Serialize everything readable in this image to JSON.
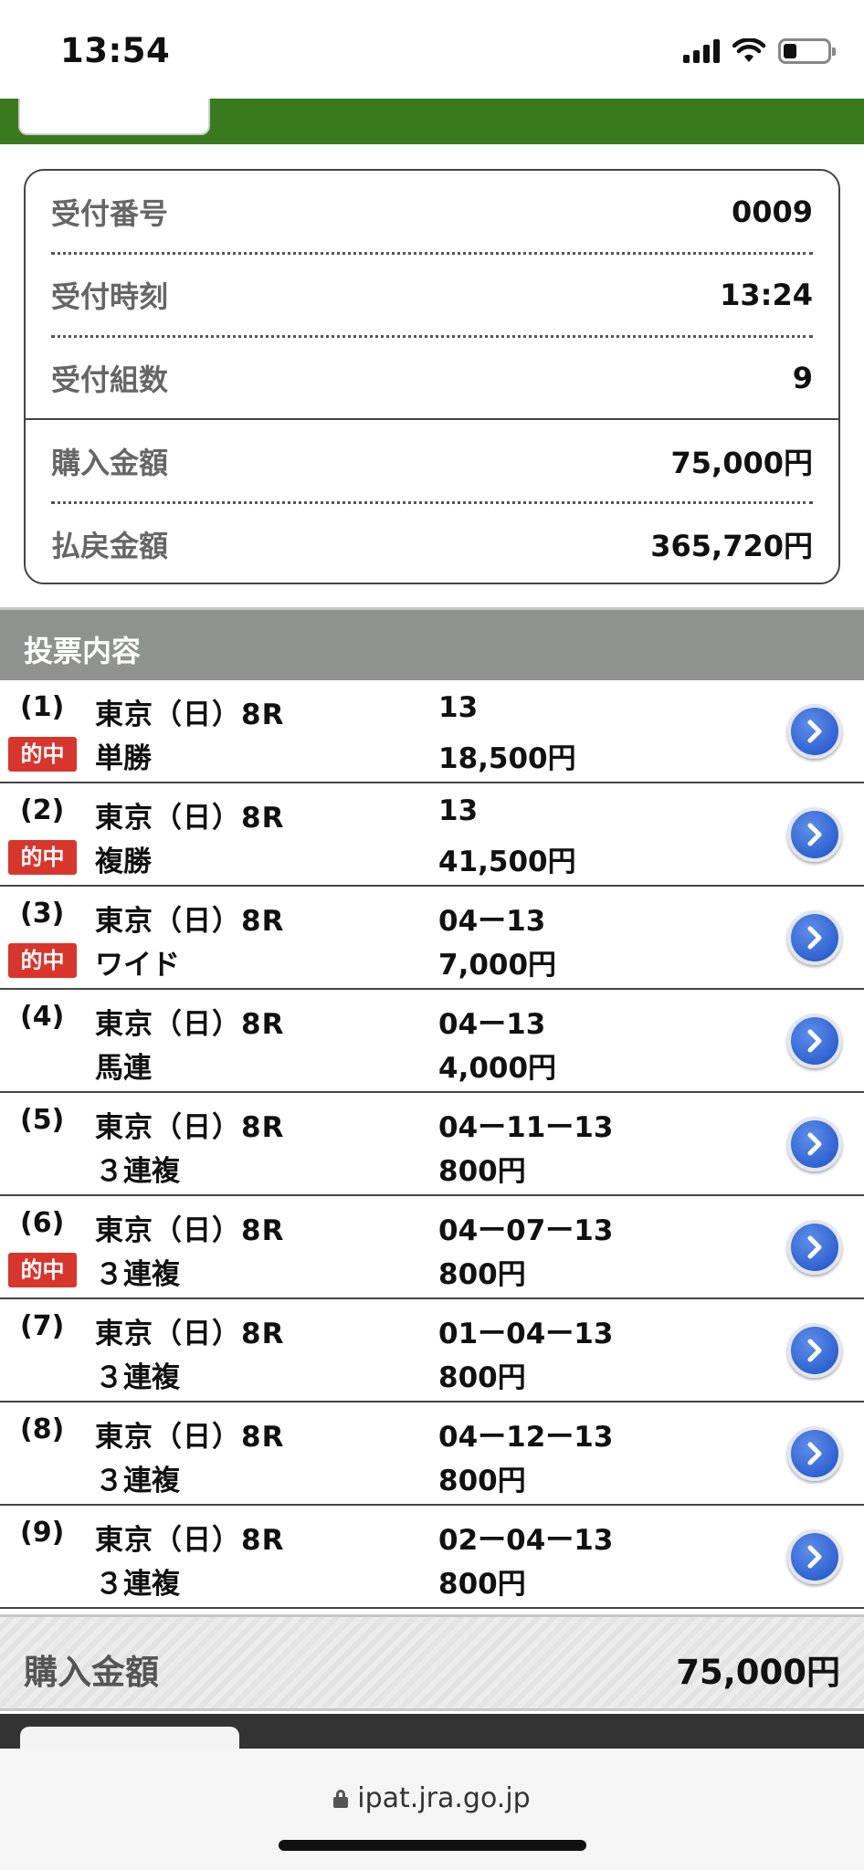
{
  "status_bar": {
    "time": "13:54"
  },
  "header": {
    "back_label": "",
    "title": ""
  },
  "summary": {
    "rows": [
      {
        "label": "受付番号",
        "value": "0009"
      },
      {
        "label": "受付時刻",
        "value": "13:24"
      },
      {
        "label": "受付組数",
        "value": "9"
      },
      {
        "label": "購入金額",
        "value": "75,000円"
      },
      {
        "label": "払戻金額",
        "value": "365,720円"
      }
    ]
  },
  "section": {
    "title": "投票内容"
  },
  "bets": [
    {
      "no": "(1)",
      "race": "東京（日）8R",
      "type": "単勝",
      "combo": "13",
      "amount": "18,500円",
      "hit": "的中"
    },
    {
      "no": "(2)",
      "race": "東京（日）8R",
      "type": "複勝",
      "combo": "13",
      "amount": "41,500円",
      "hit": "的中"
    },
    {
      "no": "(3)",
      "race": "東京（日）8R",
      "type": "ワイド",
      "combo": "04ー13",
      "amount": "7,000円",
      "hit": "的中"
    },
    {
      "no": "(4)",
      "race": "東京（日）8R",
      "type": "馬連",
      "combo": "04ー13",
      "amount": "4,000円",
      "hit": ""
    },
    {
      "no": "(5)",
      "race": "東京（日）8R",
      "type": "３連複",
      "combo": "04ー11ー13",
      "amount": "800円",
      "hit": ""
    },
    {
      "no": "(6)",
      "race": "東京（日）8R",
      "type": "３連複",
      "combo": "04ー07ー13",
      "amount": "800円",
      "hit": "的中"
    },
    {
      "no": "(7)",
      "race": "東京（日）8R",
      "type": "３連複",
      "combo": "01ー04ー13",
      "amount": "800円",
      "hit": ""
    },
    {
      "no": "(8)",
      "race": "東京（日）8R",
      "type": "３連複",
      "combo": "04ー12ー13",
      "amount": "800円",
      "hit": ""
    },
    {
      "no": "(9)",
      "race": "東京（日）8R",
      "type": "３連複",
      "combo": "02ー04ー13",
      "amount": "800円",
      "hit": ""
    }
  ],
  "total": {
    "label": "購入金額",
    "value": "75,000円"
  },
  "browser": {
    "url": "ipat.jra.go.jp"
  },
  "colors": {
    "header_green": "#3a7a1e",
    "hit_red": "#d8352c",
    "arrow_blue": "#2f63d2",
    "section_gray": "#8f938f"
  },
  "icons": {
    "arrow": "chevron-right-circle-icon",
    "lock": "lock-icon",
    "wifi": "wifi-icon",
    "signal": "signal-icon",
    "battery": "battery-icon"
  }
}
